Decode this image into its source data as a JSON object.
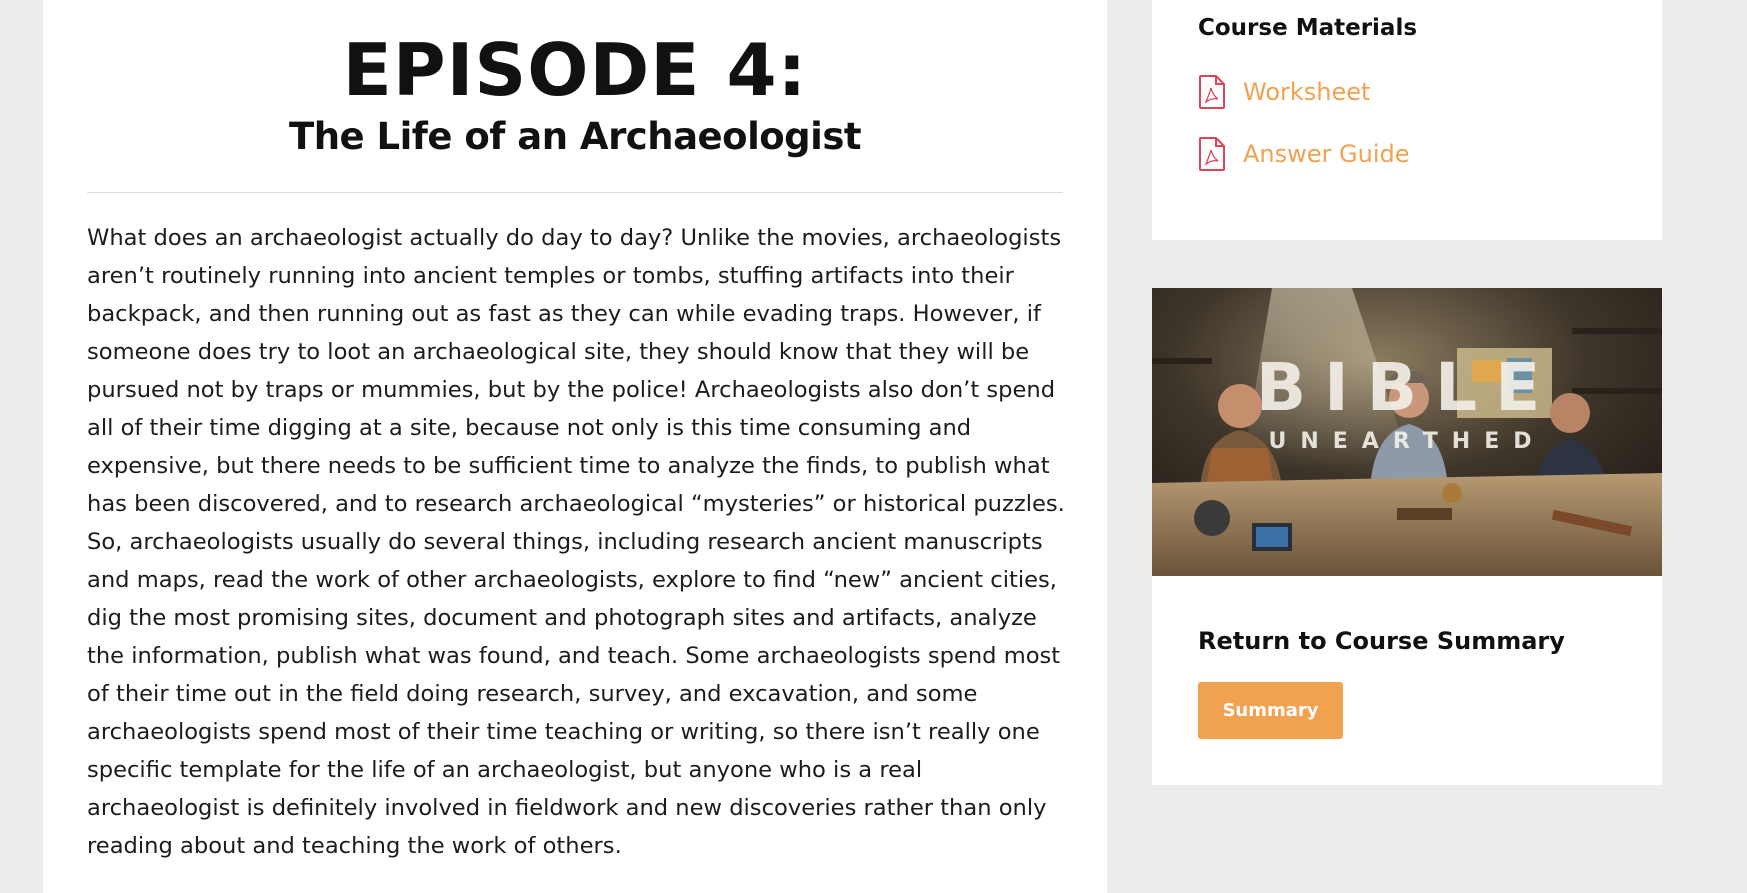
{
  "article": {
    "episode_title": "EPISODE 4:",
    "episode_subtitle": "The Life of an Archaeologist",
    "body": "What does an archaeologist actually do day to day? Unlike the movies, archaeologists aren’t routinely running into ancient temples or tombs, stuffing artifacts into their backpack, and then running out as fast as they can while evading traps. However, if someone does try to loot an archaeological site, they should know that they will be pursued not by traps or mummies, but by the police! Archaeologists also don’t spend all of their time digging at a site, because not only is this time consuming and expensive, but there needs to be sufficient time to analyze the finds, to publish what has been discovered, and to research archaeological “mysteries” or historical puzzles. So, archaeologists usually do several things, including research ancient manuscripts and maps, read the work of other archaeologists, explore to find “new” ancient cities, dig the most promising sites, document and photograph sites and artifacts, analyze the information, publish what was found, and teach. Some archaeologists spend most of their time out in the field doing research, survey, and excavation, and some archaeologists spend most of their time teaching or writing, so there isn’t really one specific template for the life of an archaeologist, but anyone who is a real archaeologist is definitely involved in fieldwork and new discoveries rather than only reading about and teaching the work of others."
  },
  "sidebar": {
    "materials_title": "Course Materials",
    "materials": [
      {
        "label": "Worksheet",
        "icon": "pdf-file-icon"
      },
      {
        "label": "Answer Guide",
        "icon": "pdf-file-icon"
      }
    ],
    "hero": {
      "title_text": "BIBLE",
      "subtitle_text": "UNEARTHED"
    },
    "return_title": "Return to Course Summary",
    "summary_button_label": "Summary"
  },
  "colors": {
    "accent": "#f0a250",
    "pdf_icon": "#e0435a",
    "page_background": "#ececec",
    "card_background": "#ffffff"
  }
}
